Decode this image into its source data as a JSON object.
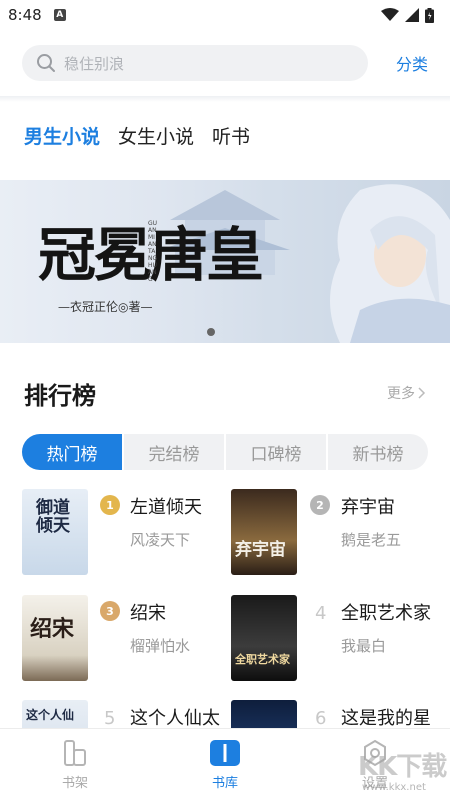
{
  "status_bar": {
    "time": "8:48",
    "notification_letter": "A"
  },
  "search": {
    "placeholder": "稳住别浪",
    "category_label": "分类"
  },
  "tabs": [
    {
      "label": "男生小说",
      "active": true
    },
    {
      "label": "女生小说",
      "active": false
    },
    {
      "label": "听书",
      "active": false
    }
  ],
  "banner": {
    "title": "冠冕唐皇",
    "pinyin": "GUANMIANTANGHUANG",
    "author_line": "—衣冠正伦◎著—",
    "page_count": 1
  },
  "ranking": {
    "title": "排行榜",
    "more_label": "更多",
    "segments": [
      "热门榜",
      "完结榜",
      "口碑榜",
      "新书榜"
    ],
    "active_segment": 0,
    "books": [
      {
        "rank": "1",
        "title": "左道倾天",
        "author": "风凌天下",
        "cover_text": "御道倾天"
      },
      {
        "rank": "2",
        "title": "弃宇宙",
        "author": "鹅是老五",
        "cover_text": "弃宇宙"
      },
      {
        "rank": "3",
        "title": "绍宋",
        "author": "榴弹怕水",
        "cover_text": "绍宋"
      },
      {
        "rank": "4",
        "title": "全职艺术家",
        "author": "我最白",
        "cover_text": "全职艺术家"
      },
      {
        "rank": "5",
        "title": "这个人仙太",
        "author": "",
        "cover_text": "这个人仙"
      },
      {
        "rank": "6",
        "title": "这是我的星",
        "author": "",
        "cover_text": ""
      }
    ]
  },
  "bottom_nav": [
    {
      "label": "书架",
      "icon": "bookshelf-icon",
      "active": false
    },
    {
      "label": "书库",
      "icon": "library-icon",
      "active": true
    },
    {
      "label": "设置",
      "icon": "settings-icon",
      "active": false
    }
  ],
  "watermark": {
    "text": "KK下载",
    "url": "www.kkx.net"
  },
  "colors": {
    "accent": "#1d7fe0",
    "gold": "#e3b64d",
    "silver": "#b5b5b5",
    "bronze": "#d9a86a"
  }
}
